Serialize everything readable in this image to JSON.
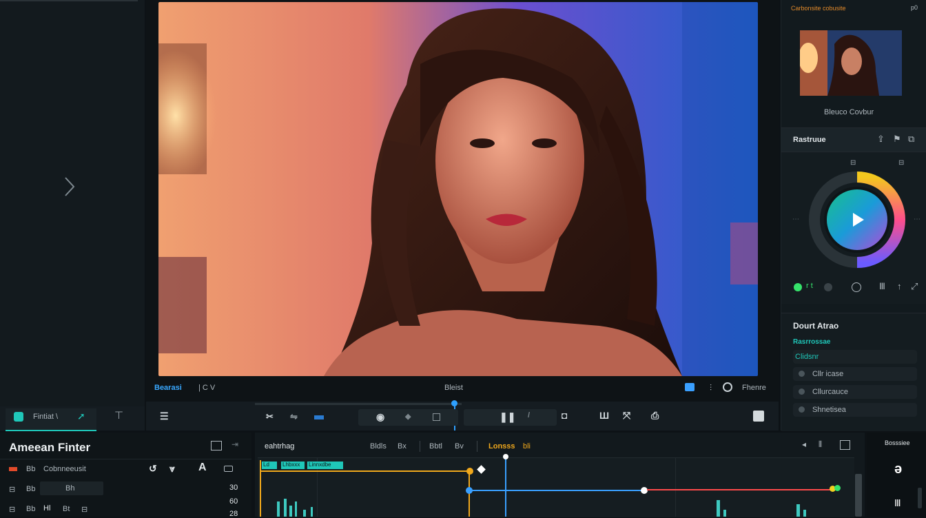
{
  "viewer": {
    "timecode_left": "Bearasi",
    "mode_label": "| C V",
    "center_label": "Bleist",
    "right_label": "Fhenre"
  },
  "left_tab": {
    "label": "Fintiat \\"
  },
  "right_panel": {
    "header_top": "Carbonsite cobusite",
    "header_top_right": "p0",
    "thumb_caption": "Bleuco Covbur",
    "section1_title": "Rastruue",
    "section2_title": "Dourt Atrao",
    "section2_sub": "Rasrrossae",
    "preset_field": "Clidsnr",
    "list_items": [
      "Cllr icase",
      "Cllurcauce",
      "Shnetisea"
    ]
  },
  "effect_panel": {
    "title": "Ameean Finter",
    "row1": [
      "Bb",
      "Cobnneeusit"
    ],
    "row2": [
      "Bb",
      "Bh"
    ],
    "row3": [
      "Bb",
      "Hl",
      "Bt"
    ],
    "values": [
      "30",
      "60",
      "28"
    ]
  },
  "timeline": {
    "title": "eahtrhag",
    "tab1": "Bldls",
    "tab2": "Bx",
    "tab3": "Bbtl",
    "tab4": "Bv",
    "tab_active": "Lonsss",
    "tab_active_suffix": "bli",
    "clip_labels": [
      "Ld",
      "Lhbxxx",
      "Linnxdbe"
    ]
  },
  "bottom_right": {
    "label": "Bosssiee"
  },
  "colors": {
    "accent_teal": "#1fc7b9",
    "accent_blue": "#3aa0ff",
    "accent_orange": "#f0a81c",
    "accent_red": "#ff4b4b",
    "accent_green": "#35e26a"
  }
}
